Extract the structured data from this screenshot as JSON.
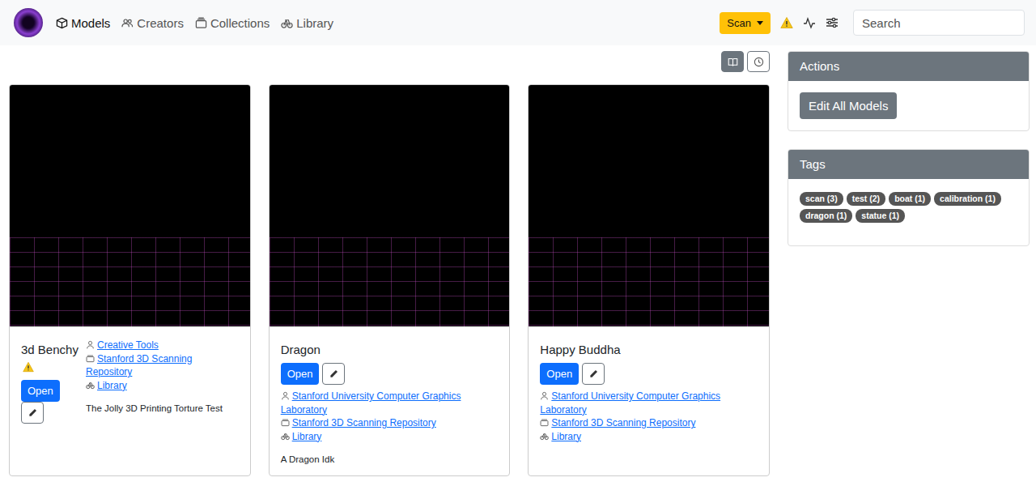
{
  "nav": {
    "items": [
      {
        "label": "Models",
        "selected": true,
        "icon": "box"
      },
      {
        "label": "Creators",
        "selected": false,
        "icon": "people"
      },
      {
        "label": "Collections",
        "selected": false,
        "icon": "collection"
      },
      {
        "label": "Library",
        "selected": false,
        "icon": "library"
      }
    ]
  },
  "scan_button": {
    "label": "Scan"
  },
  "search": {
    "placeholder": "Search"
  },
  "models": [
    {
      "kind": "split",
      "title": "3d Benchy",
      "warning": true,
      "open_label": "Open",
      "creator": "Creative Tools",
      "collection": "Stanford 3D Scanning Repository",
      "library": "Library",
      "description": "The Jolly 3D Printing Torture Test"
    },
    {
      "kind": "stacked",
      "title": "Dragon",
      "warning": false,
      "open_label": "Open",
      "creator": "Stanford University Computer Graphics Laboratory",
      "collection": "Stanford 3D Scanning Repository",
      "library": "Library",
      "description": "A Dragon Idk"
    },
    {
      "kind": "stacked",
      "title": "Happy Buddha",
      "warning": false,
      "open_label": "Open",
      "creator": "Stanford University Computer Graphics Laboratory",
      "collection": "Stanford 3D Scanning Repository",
      "library": "Library",
      "description": ""
    }
  ],
  "actions": {
    "title": "Actions",
    "buttons": [
      "Edit All Models"
    ]
  },
  "tags": {
    "title": "Tags",
    "items": [
      "scan (3)",
      "test (2)",
      "boat (1)",
      "calibration (1)",
      "dragon (1)",
      "statue (1)"
    ]
  }
}
